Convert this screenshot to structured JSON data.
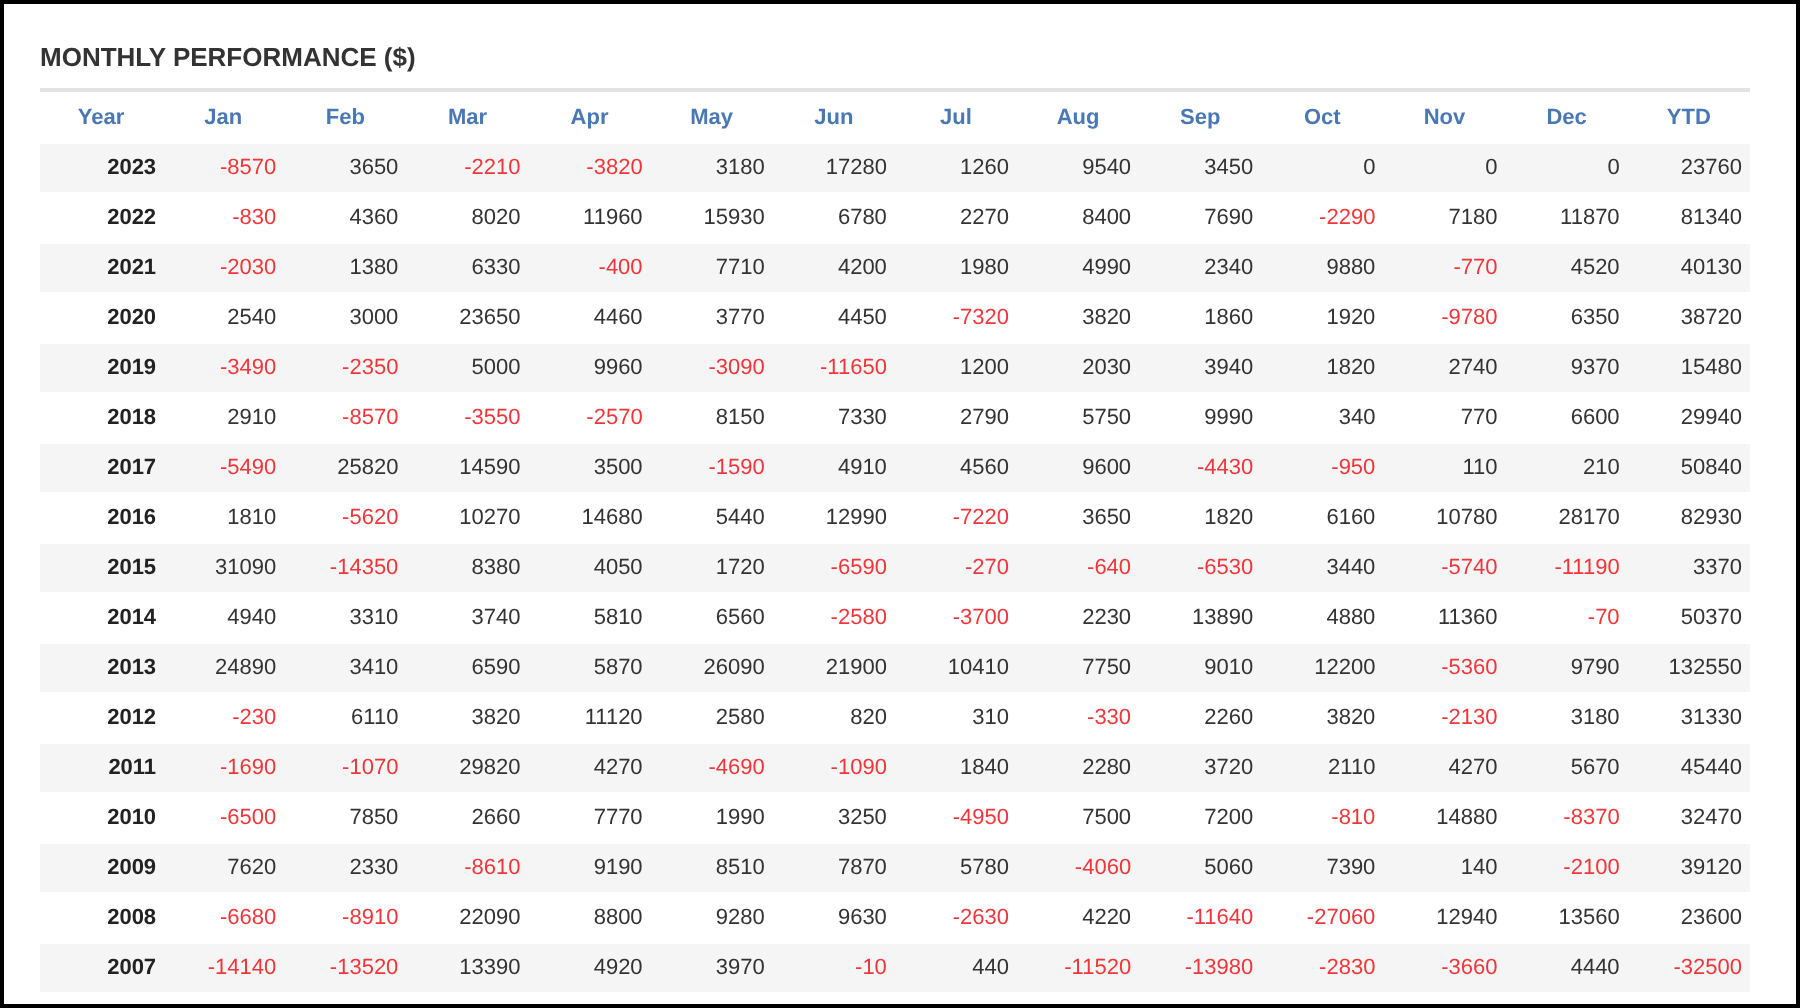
{
  "title": "MONTHLY PERFORMANCE ($)",
  "table": {
    "columns": [
      "Year",
      "Jan",
      "Feb",
      "Mar",
      "Apr",
      "May",
      "Jun",
      "Jul",
      "Aug",
      "Sep",
      "Oct",
      "Nov",
      "Dec",
      "YTD"
    ],
    "rows": [
      [
        {
          "value": "2023",
          "kind": "year"
        },
        {
          "value": "-8570",
          "kind": "loss"
        },
        {
          "value": "3650",
          "kind": "gain"
        },
        {
          "value": "-2210",
          "kind": "loss"
        },
        {
          "value": "-3820",
          "kind": "loss"
        },
        {
          "value": "3180",
          "kind": "gain"
        },
        {
          "value": "17280",
          "kind": "gain"
        },
        {
          "value": "1260",
          "kind": "gain"
        },
        {
          "value": "9540",
          "kind": "gain"
        },
        {
          "value": "3450",
          "kind": "gain"
        },
        {
          "value": "0",
          "kind": "gain"
        },
        {
          "value": "0",
          "kind": "gain"
        },
        {
          "value": "0",
          "kind": "gain"
        },
        {
          "value": "23760",
          "kind": "gain"
        }
      ],
      [
        {
          "value": "2022",
          "kind": "year"
        },
        {
          "value": "-830",
          "kind": "loss"
        },
        {
          "value": "4360",
          "kind": "gain"
        },
        {
          "value": "8020",
          "kind": "gain"
        },
        {
          "value": "11960",
          "kind": "gain"
        },
        {
          "value": "15930",
          "kind": "gain"
        },
        {
          "value": "6780",
          "kind": "gain"
        },
        {
          "value": "2270",
          "kind": "gain"
        },
        {
          "value": "8400",
          "kind": "gain"
        },
        {
          "value": "7690",
          "kind": "gain"
        },
        {
          "value": "-2290",
          "kind": "loss"
        },
        {
          "value": "7180",
          "kind": "gain"
        },
        {
          "value": "11870",
          "kind": "gain"
        },
        {
          "value": "81340",
          "kind": "gain"
        }
      ],
      [
        {
          "value": "2021",
          "kind": "year"
        },
        {
          "value": "-2030",
          "kind": "loss"
        },
        {
          "value": "1380",
          "kind": "gain"
        },
        {
          "value": "6330",
          "kind": "gain"
        },
        {
          "value": "-400",
          "kind": "loss"
        },
        {
          "value": "7710",
          "kind": "gain"
        },
        {
          "value": "4200",
          "kind": "gain"
        },
        {
          "value": "1980",
          "kind": "gain"
        },
        {
          "value": "4990",
          "kind": "gain"
        },
        {
          "value": "2340",
          "kind": "gain"
        },
        {
          "value": "9880",
          "kind": "gain"
        },
        {
          "value": "-770",
          "kind": "loss"
        },
        {
          "value": "4520",
          "kind": "gain"
        },
        {
          "value": "40130",
          "kind": "gain"
        }
      ],
      [
        {
          "value": "2020",
          "kind": "year"
        },
        {
          "value": "2540",
          "kind": "gain"
        },
        {
          "value": "3000",
          "kind": "gain"
        },
        {
          "value": "23650",
          "kind": "gain"
        },
        {
          "value": "4460",
          "kind": "gain"
        },
        {
          "value": "3770",
          "kind": "gain"
        },
        {
          "value": "4450",
          "kind": "gain"
        },
        {
          "value": "-7320",
          "kind": "loss"
        },
        {
          "value": "3820",
          "kind": "gain"
        },
        {
          "value": "1860",
          "kind": "gain"
        },
        {
          "value": "1920",
          "kind": "gain"
        },
        {
          "value": "-9780",
          "kind": "loss"
        },
        {
          "value": "6350",
          "kind": "gain"
        },
        {
          "value": "38720",
          "kind": "gain"
        }
      ],
      [
        {
          "value": "2019",
          "kind": "year"
        },
        {
          "value": "-3490",
          "kind": "loss"
        },
        {
          "value": "-2350",
          "kind": "loss"
        },
        {
          "value": "5000",
          "kind": "gain"
        },
        {
          "value": "9960",
          "kind": "gain"
        },
        {
          "value": "-3090",
          "kind": "loss"
        },
        {
          "value": "-11650",
          "kind": "loss"
        },
        {
          "value": "1200",
          "kind": "gain"
        },
        {
          "value": "2030",
          "kind": "gain"
        },
        {
          "value": "3940",
          "kind": "gain"
        },
        {
          "value": "1820",
          "kind": "gain"
        },
        {
          "value": "2740",
          "kind": "gain"
        },
        {
          "value": "9370",
          "kind": "gain"
        },
        {
          "value": "15480",
          "kind": "gain"
        }
      ],
      [
        {
          "value": "2018",
          "kind": "year"
        },
        {
          "value": "2910",
          "kind": "gain"
        },
        {
          "value": "-8570",
          "kind": "loss"
        },
        {
          "value": "-3550",
          "kind": "loss"
        },
        {
          "value": "-2570",
          "kind": "loss"
        },
        {
          "value": "8150",
          "kind": "gain"
        },
        {
          "value": "7330",
          "kind": "gain"
        },
        {
          "value": "2790",
          "kind": "gain"
        },
        {
          "value": "5750",
          "kind": "gain"
        },
        {
          "value": "9990",
          "kind": "gain"
        },
        {
          "value": "340",
          "kind": "gain"
        },
        {
          "value": "770",
          "kind": "gain"
        },
        {
          "value": "6600",
          "kind": "gain"
        },
        {
          "value": "29940",
          "kind": "gain"
        }
      ],
      [
        {
          "value": "2017",
          "kind": "year"
        },
        {
          "value": "-5490",
          "kind": "loss"
        },
        {
          "value": "25820",
          "kind": "gain"
        },
        {
          "value": "14590",
          "kind": "gain"
        },
        {
          "value": "3500",
          "kind": "gain"
        },
        {
          "value": "-1590",
          "kind": "loss"
        },
        {
          "value": "4910",
          "kind": "gain"
        },
        {
          "value": "4560",
          "kind": "gain"
        },
        {
          "value": "9600",
          "kind": "gain"
        },
        {
          "value": "-4430",
          "kind": "loss"
        },
        {
          "value": "-950",
          "kind": "loss"
        },
        {
          "value": "110",
          "kind": "gain"
        },
        {
          "value": "210",
          "kind": "gain"
        },
        {
          "value": "50840",
          "kind": "gain"
        }
      ],
      [
        {
          "value": "2016",
          "kind": "year"
        },
        {
          "value": "1810",
          "kind": "gain"
        },
        {
          "value": "-5620",
          "kind": "loss"
        },
        {
          "value": "10270",
          "kind": "gain"
        },
        {
          "value": "14680",
          "kind": "gain"
        },
        {
          "value": "5440",
          "kind": "gain"
        },
        {
          "value": "12990",
          "kind": "gain"
        },
        {
          "value": "-7220",
          "kind": "loss"
        },
        {
          "value": "3650",
          "kind": "gain"
        },
        {
          "value": "1820",
          "kind": "gain"
        },
        {
          "value": "6160",
          "kind": "gain"
        },
        {
          "value": "10780",
          "kind": "gain"
        },
        {
          "value": "28170",
          "kind": "gain"
        },
        {
          "value": "82930",
          "kind": "gain"
        }
      ],
      [
        {
          "value": "2015",
          "kind": "year"
        },
        {
          "value": "31090",
          "kind": "gain"
        },
        {
          "value": "-14350",
          "kind": "loss"
        },
        {
          "value": "8380",
          "kind": "gain"
        },
        {
          "value": "4050",
          "kind": "gain"
        },
        {
          "value": "1720",
          "kind": "gain"
        },
        {
          "value": "-6590",
          "kind": "loss"
        },
        {
          "value": "-270",
          "kind": "loss"
        },
        {
          "value": "-640",
          "kind": "loss"
        },
        {
          "value": "-6530",
          "kind": "loss"
        },
        {
          "value": "3440",
          "kind": "gain"
        },
        {
          "value": "-5740",
          "kind": "loss"
        },
        {
          "value": "-11190",
          "kind": "loss"
        },
        {
          "value": "3370",
          "kind": "gain"
        }
      ],
      [
        {
          "value": "2014",
          "kind": "year"
        },
        {
          "value": "4940",
          "kind": "gain"
        },
        {
          "value": "3310",
          "kind": "gain"
        },
        {
          "value": "3740",
          "kind": "gain"
        },
        {
          "value": "5810",
          "kind": "gain"
        },
        {
          "value": "6560",
          "kind": "gain"
        },
        {
          "value": "-2580",
          "kind": "loss"
        },
        {
          "value": "-3700",
          "kind": "loss"
        },
        {
          "value": "2230",
          "kind": "gain"
        },
        {
          "value": "13890",
          "kind": "gain"
        },
        {
          "value": "4880",
          "kind": "gain"
        },
        {
          "value": "11360",
          "kind": "gain"
        },
        {
          "value": "-70",
          "kind": "loss"
        },
        {
          "value": "50370",
          "kind": "gain"
        }
      ],
      [
        {
          "value": "2013",
          "kind": "year"
        },
        {
          "value": "24890",
          "kind": "gain"
        },
        {
          "value": "3410",
          "kind": "gain"
        },
        {
          "value": "6590",
          "kind": "gain"
        },
        {
          "value": "5870",
          "kind": "gain"
        },
        {
          "value": "26090",
          "kind": "gain"
        },
        {
          "value": "21900",
          "kind": "gain"
        },
        {
          "value": "10410",
          "kind": "gain"
        },
        {
          "value": "7750",
          "kind": "gain"
        },
        {
          "value": "9010",
          "kind": "gain"
        },
        {
          "value": "12200",
          "kind": "gain"
        },
        {
          "value": "-5360",
          "kind": "loss"
        },
        {
          "value": "9790",
          "kind": "gain"
        },
        {
          "value": "132550",
          "kind": "gain"
        }
      ],
      [
        {
          "value": "2012",
          "kind": "year"
        },
        {
          "value": "-230",
          "kind": "loss"
        },
        {
          "value": "6110",
          "kind": "gain"
        },
        {
          "value": "3820",
          "kind": "gain"
        },
        {
          "value": "11120",
          "kind": "gain"
        },
        {
          "value": "2580",
          "kind": "gain"
        },
        {
          "value": "820",
          "kind": "gain"
        },
        {
          "value": "310",
          "kind": "gain"
        },
        {
          "value": "-330",
          "kind": "loss"
        },
        {
          "value": "2260",
          "kind": "gain"
        },
        {
          "value": "3820",
          "kind": "gain"
        },
        {
          "value": "-2130",
          "kind": "loss"
        },
        {
          "value": "3180",
          "kind": "gain"
        },
        {
          "value": "31330",
          "kind": "gain"
        }
      ],
      [
        {
          "value": "2011",
          "kind": "year"
        },
        {
          "value": "-1690",
          "kind": "loss"
        },
        {
          "value": "-1070",
          "kind": "loss"
        },
        {
          "value": "29820",
          "kind": "gain"
        },
        {
          "value": "4270",
          "kind": "gain"
        },
        {
          "value": "-4690",
          "kind": "loss"
        },
        {
          "value": "-1090",
          "kind": "loss"
        },
        {
          "value": "1840",
          "kind": "gain"
        },
        {
          "value": "2280",
          "kind": "gain"
        },
        {
          "value": "3720",
          "kind": "gain"
        },
        {
          "value": "2110",
          "kind": "gain"
        },
        {
          "value": "4270",
          "kind": "gain"
        },
        {
          "value": "5670",
          "kind": "gain"
        },
        {
          "value": "45440",
          "kind": "gain"
        }
      ],
      [
        {
          "value": "2010",
          "kind": "year"
        },
        {
          "value": "-6500",
          "kind": "loss"
        },
        {
          "value": "7850",
          "kind": "gain"
        },
        {
          "value": "2660",
          "kind": "gain"
        },
        {
          "value": "7770",
          "kind": "gain"
        },
        {
          "value": "1990",
          "kind": "gain"
        },
        {
          "value": "3250",
          "kind": "gain"
        },
        {
          "value": "-4950",
          "kind": "loss"
        },
        {
          "value": "7500",
          "kind": "gain"
        },
        {
          "value": "7200",
          "kind": "gain"
        },
        {
          "value": "-810",
          "kind": "loss"
        },
        {
          "value": "14880",
          "kind": "gain"
        },
        {
          "value": "-8370",
          "kind": "loss"
        },
        {
          "value": "32470",
          "kind": "gain"
        }
      ],
      [
        {
          "value": "2009",
          "kind": "year"
        },
        {
          "value": "7620",
          "kind": "gain"
        },
        {
          "value": "2330",
          "kind": "gain"
        },
        {
          "value": "-8610",
          "kind": "loss"
        },
        {
          "value": "9190",
          "kind": "gain"
        },
        {
          "value": "8510",
          "kind": "gain"
        },
        {
          "value": "7870",
          "kind": "gain"
        },
        {
          "value": "5780",
          "kind": "gain"
        },
        {
          "value": "-4060",
          "kind": "loss"
        },
        {
          "value": "5060",
          "kind": "gain"
        },
        {
          "value": "7390",
          "kind": "gain"
        },
        {
          "value": "140",
          "kind": "gain"
        },
        {
          "value": "-2100",
          "kind": "loss"
        },
        {
          "value": "39120",
          "kind": "gain"
        }
      ],
      [
        {
          "value": "2008",
          "kind": "year"
        },
        {
          "value": "-6680",
          "kind": "loss"
        },
        {
          "value": "-8910",
          "kind": "loss"
        },
        {
          "value": "22090",
          "kind": "gain"
        },
        {
          "value": "8800",
          "kind": "gain"
        },
        {
          "value": "9280",
          "kind": "gain"
        },
        {
          "value": "9630",
          "kind": "gain"
        },
        {
          "value": "-2630",
          "kind": "loss"
        },
        {
          "value": "4220",
          "kind": "gain"
        },
        {
          "value": "-11640",
          "kind": "loss"
        },
        {
          "value": "-27060",
          "kind": "loss"
        },
        {
          "value": "12940",
          "kind": "gain"
        },
        {
          "value": "13560",
          "kind": "gain"
        },
        {
          "value": "23600",
          "kind": "gain"
        }
      ],
      [
        {
          "value": "2007",
          "kind": "year"
        },
        {
          "value": "-14140",
          "kind": "loss"
        },
        {
          "value": "-13520",
          "kind": "loss"
        },
        {
          "value": "13390",
          "kind": "gain"
        },
        {
          "value": "4920",
          "kind": "gain"
        },
        {
          "value": "3970",
          "kind": "gain"
        },
        {
          "value": "-10",
          "kind": "loss"
        },
        {
          "value": "440",
          "kind": "gain"
        },
        {
          "value": "-11520",
          "kind": "loss"
        },
        {
          "value": "-13980",
          "kind": "loss"
        },
        {
          "value": "-2830",
          "kind": "loss"
        },
        {
          "value": "-3660",
          "kind": "loss"
        },
        {
          "value": "4440",
          "kind": "gain"
        },
        {
          "value": "-32500",
          "kind": "loss"
        }
      ]
    ]
  }
}
